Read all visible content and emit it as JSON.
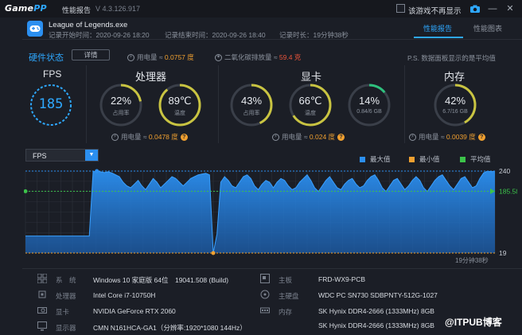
{
  "titlebar": {
    "logo_a": "Game",
    "logo_b": "PP",
    "app_title": "性能报告",
    "version": "V 4.3.126.917",
    "dont_show_label": "该游戏不再显示"
  },
  "game": {
    "name": "League of Legends.exe",
    "start": "记录开始时间：2020-09-26 18:20",
    "end": "记录结束时间：2020-09-26 18:40",
    "duration": "记录时长：19分钟38秒"
  },
  "tabs": {
    "report": "性能报告",
    "chart": "性能图表"
  },
  "hardware": {
    "title": "硬件状态",
    "detail_button": "详情",
    "power_label": "用电量 ≈",
    "power_value": "0.0757 度",
    "co2_label": "二氧化碳排放量 ≈",
    "co2_value": "59.4 克",
    "note": "P.S. 数据面板显示的是平均值"
  },
  "fps": {
    "label": "FPS",
    "value": "185"
  },
  "cpu": {
    "title": "处理器",
    "usage": "22%",
    "usage_sub": "占用率",
    "usage_level": 0.22,
    "temp": "89℃",
    "temp_sub": "温度",
    "temp_level": 0.89,
    "power_label": "用电量 ≈",
    "power_value": "0.0478 度"
  },
  "gpu": {
    "title": "显卡",
    "usage": "43%",
    "usage_sub": "占用率",
    "usage_level": 0.43,
    "temp": "66℃",
    "temp_sub": "温度",
    "temp_level": 0.66,
    "vram": "14%",
    "vram_sub": "0.84/6 GB",
    "vram_level": 0.14,
    "power_label": "用电量 ≈",
    "power_value": "0.024 度"
  },
  "memory": {
    "title": "内存",
    "usage": "42%",
    "usage_sub": "6.7/16 GB",
    "usage_level": 0.42,
    "power_label": "用电量 ≈",
    "power_value": "0.0039 度"
  },
  "chart_select": {
    "value": "FPS"
  },
  "legend": {
    "max": "最大值",
    "min": "最小值",
    "avg": "平均值"
  },
  "colors": {
    "accent": "#2ea8ff",
    "max": "#2b8ff0",
    "min": "#f0a030",
    "avg": "#3cc34a"
  },
  "chart_data": {
    "type": "area",
    "series": [
      {
        "values": [
          65,
          65,
          65,
          65,
          65,
          65,
          65,
          65,
          65,
          65,
          65,
          65,
          65,
          65,
          65,
          65,
          65,
          65,
          238,
          240,
          238,
          236,
          238,
          235,
          230,
          225,
          210,
          200,
          195,
          205,
          215,
          200,
          190,
          205,
          220,
          210,
          195,
          205,
          215,
          225,
          220,
          210,
          200,
          210,
          220,
          225,
          230,
          232,
          234,
          230,
          19,
          70,
          210,
          225,
          215,
          200,
          195,
          210,
          225,
          230,
          220,
          200,
          190,
          205,
          215,
          210,
          195,
          210,
          220,
          215,
          200,
          190,
          195,
          210,
          220,
          230,
          215,
          195,
          185,
          200,
          215,
          225,
          210,
          195,
          190,
          205,
          215,
          220,
          205,
          195,
          200,
          215,
          225,
          230,
          215,
          195,
          185,
          200,
          215,
          220,
          205,
          190,
          200,
          215,
          225,
          215,
          195,
          185,
          200,
          215,
          225,
          230,
          215,
          200,
          190,
          205,
          220,
          225,
          210,
          195,
          200,
          220,
          235,
          240,
          238,
          240
        ]
      }
    ],
    "max": 240,
    "min": 19,
    "avg": 185.58,
    "ylim": [
      19,
      240
    ],
    "max_label": "240",
    "avg_label": "185.58",
    "min_label": "19",
    "x_end_label": "19分钟38秒"
  },
  "sysinfo": {
    "os_label": "系　统",
    "os": "Windows 10 家庭版 64位　19041.508 (Build)",
    "cpu_label": "处理器",
    "cpu": "Intel Core i7-10750H",
    "gpu_label": "显卡",
    "gpu": "NVIDIA GeForce RTX 2060",
    "monitor_label": "显示器",
    "monitor": "CMN N161HCA-GA1（分辨率:1920*1080 144Hz）",
    "board_label": "主板",
    "board": "FRD-WX9-PCB",
    "disk_label": "主硬盘",
    "disk": "WDC PC SN730 SDBPNTY-512G-1027",
    "ram_label": "内存",
    "ram1": "SK Hynix DDR4-2666 (1333MHz) 8GB",
    "ram2": "SK Hynix DDR4-2666 (1333MHz) 8GB"
  },
  "watermark": "@ITPUB博客"
}
